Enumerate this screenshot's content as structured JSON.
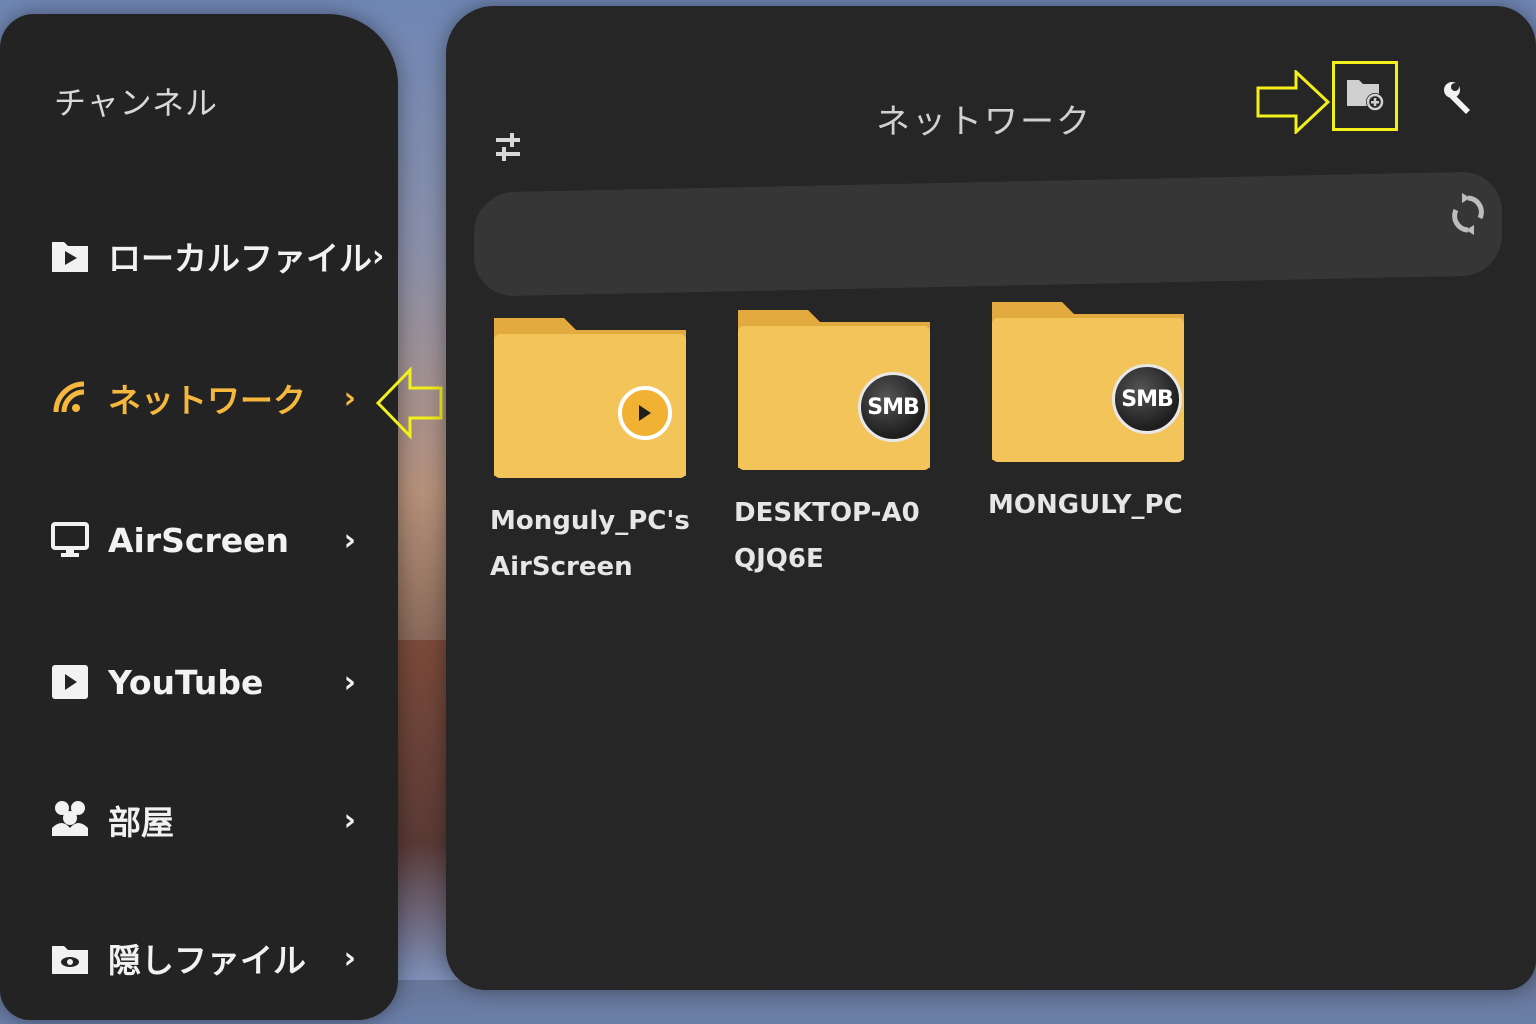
{
  "sidebar": {
    "title": "チャンネル",
    "items": [
      {
        "label": "ローカルファイル",
        "icon": "play-file-icon",
        "chevron": "›"
      },
      {
        "label": "ネットワーク",
        "icon": "wifi-icon",
        "chevron": "›",
        "active": true
      },
      {
        "label": "AirScreen",
        "icon": "monitor-icon",
        "chevron": "›"
      },
      {
        "label": "YouTube",
        "icon": "youtube-icon",
        "chevron": "›"
      },
      {
        "label": "部屋",
        "icon": "people-icon",
        "chevron": "›"
      },
      {
        "label": "隠しファイル",
        "icon": "hidden-folder-icon",
        "chevron": "›"
      }
    ]
  },
  "main": {
    "title": "ネットワーク",
    "folders": [
      {
        "label": "Monguly_PC's AirScreen",
        "badge": "play"
      },
      {
        "label": "DESKTOP-A0QJQ6E",
        "badge": "SMB"
      },
      {
        "label": "MONGULY_PC",
        "badge": "SMB"
      }
    ]
  },
  "colors": {
    "accent": "#f5b83d",
    "folder": "#f3c45a",
    "highlight": "#f2ef1a",
    "panel": "#262626"
  }
}
